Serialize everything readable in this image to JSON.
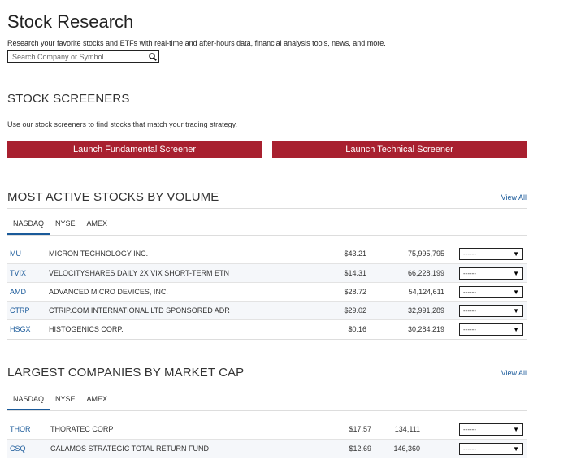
{
  "header": {
    "title": "Stock Research",
    "subtitle": "Research your favorite stocks and ETFs with real-time and after-hours data, financial analysis tools, news, and more.",
    "search_placeholder": "Search Company or Symbol",
    "search_icon": "search-icon"
  },
  "screeners": {
    "title": "STOCK SCREENERS",
    "description": "Use our stock screeners to find stocks that match your trading strategy.",
    "fundamental_label": "Launch Fundamental Screener",
    "technical_label": "Launch Technical Screener",
    "button_color": "#a8202f"
  },
  "most_active": {
    "title": "MOST ACTIVE STOCKS BY VOLUME",
    "view_all": "View All",
    "tabs": [
      "NASDAQ",
      "NYSE",
      "AMEX"
    ],
    "active_tab": "NASDAQ",
    "rows": [
      {
        "symbol": "MU",
        "name": "MICRON TECHNOLOGY INC.",
        "price": "$43.21",
        "volume": "75,995,795",
        "action": "------"
      },
      {
        "symbol": "TVIX",
        "name": "VELOCITYSHARES DAILY 2X VIX SHORT-TERM ETN",
        "price": "$14.31",
        "volume": "66,228,199",
        "action": "------"
      },
      {
        "symbol": "AMD",
        "name": "ADVANCED MICRO DEVICES, INC.",
        "price": "$28.72",
        "volume": "54,124,611",
        "action": "------"
      },
      {
        "symbol": "CTRP",
        "name": "CTRIP.COM INTERNATIONAL LTD SPONSORED ADR",
        "price": "$29.02",
        "volume": "32,991,289",
        "action": "------"
      },
      {
        "symbol": "HSGX",
        "name": "HISTOGENICS CORP.",
        "price": "$0.16",
        "volume": "30,284,219",
        "action": "------"
      }
    ]
  },
  "largest": {
    "title": "LARGEST COMPANIES BY MARKET CAP",
    "view_all": "View All",
    "tabs": [
      "NASDAQ",
      "NYSE",
      "AMEX"
    ],
    "active_tab": "NASDAQ",
    "rows": [
      {
        "symbol": "THOR",
        "name": "THORATEC CORP",
        "price": "$17.57",
        "volume": "134,111",
        "action": "------"
      },
      {
        "symbol": "CSQ",
        "name": "CALAMOS STRATEGIC TOTAL RETURN FUND",
        "price": "$12.69",
        "volume": "146,360",
        "action": "------"
      }
    ]
  },
  "colors": {
    "link": "#1a5a9a",
    "accent": "#a8202f"
  }
}
